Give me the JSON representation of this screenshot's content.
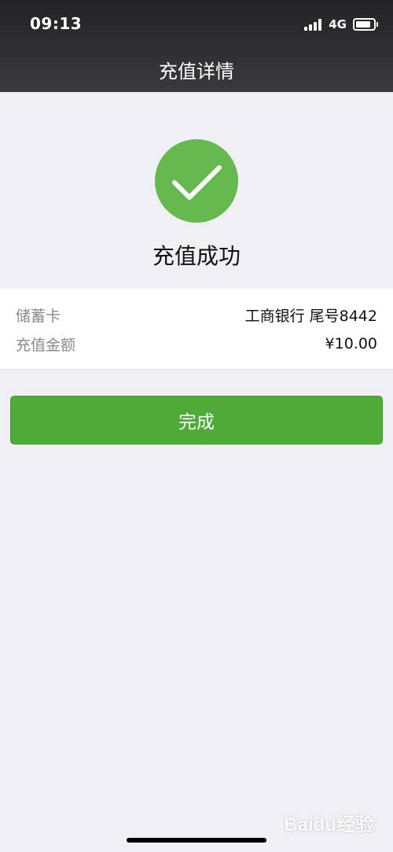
{
  "status_bar": {
    "time": "09:13",
    "network": "4G",
    "signal_icon": "signal-bars-icon",
    "battery_icon": "battery-icon"
  },
  "nav": {
    "title": "充值详情"
  },
  "result": {
    "icon": "checkmark-icon",
    "icon_color": "#66b94f",
    "title": "充值成功"
  },
  "details": {
    "rows": [
      {
        "label": "储蓄卡",
        "value": "工商银行 尾号8442"
      },
      {
        "label": "充值金额",
        "value": "¥10.00"
      }
    ]
  },
  "actions": {
    "done_label": "完成",
    "done_color": "#4faa38"
  },
  "watermark": {
    "text": "Baidu经验"
  },
  "colors": {
    "page_background": "#efeff4",
    "nav_background": "#2f2f32"
  }
}
